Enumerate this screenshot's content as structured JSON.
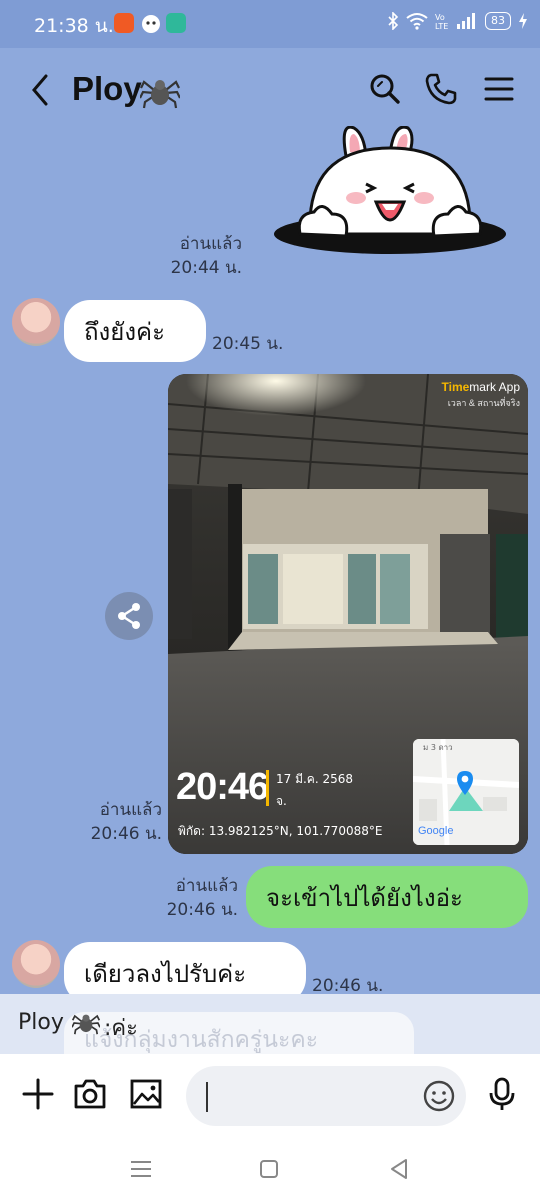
{
  "status_bar": {
    "time": "21:38 น.",
    "battery": "83",
    "colors": {
      "app1": "#f05a24",
      "app3": "#2fb89a"
    },
    "icons": [
      "bluetooth-icon",
      "wifi-icon",
      "volte-icon",
      "signal-icon",
      "battery-icon",
      "charging-icon"
    ]
  },
  "header": {
    "title": "Ploy",
    "icons": [
      "back-icon",
      "spider-emoji",
      "search-icon",
      "call-icon",
      "menu-icon"
    ]
  },
  "messages": [
    {
      "type": "sticker",
      "side": "right",
      "name": "cony-bunny-sticker",
      "read": "อ่านแล้ว",
      "time": "20:44 น."
    },
    {
      "type": "text",
      "side": "left",
      "text": "ถึงยังค่ะ",
      "time": "20:45 น."
    },
    {
      "type": "image",
      "side": "right",
      "read": "อ่านแล้ว",
      "time": "20:46 น.",
      "stamp": {
        "brand_accent": "Time",
        "brand_rest": "mark App",
        "brand_sub": "เวลา & สถานที่จริง",
        "time": "20:46",
        "date": "17 มี.ค. 2568",
        "weekday": "จ.",
        "coords": "พิกัด: 13.982125°N, 101.770088°E",
        "map_label": "ม 3 ดาว",
        "map_brand": "Google"
      }
    },
    {
      "type": "text",
      "side": "right",
      "text": "จะเข้าไปได้ยังไงอ่ะ",
      "read": "อ่านแล้ว",
      "time": "20:46 น."
    },
    {
      "type": "text",
      "side": "left",
      "text": "เดียวลงไปรับค่ะ",
      "time": "20:46 น."
    }
  ],
  "preview": {
    "sender": "Ploy",
    "tail": ":ค่ะ",
    "ghost_text": "แจ้งกลุ่มงานสักครู่นะคะ"
  },
  "composer": {
    "placeholder": "",
    "icons": [
      "plus-icon",
      "camera-icon",
      "image-icon",
      "emoji-icon",
      "microphone-icon"
    ]
  },
  "nav_bar": {
    "icons": [
      "recent-apps-icon",
      "home-icon",
      "back-nav-icon"
    ]
  },
  "colors": {
    "background": "#8ea9dc",
    "bubble_sent": "#86de7b",
    "bubble_received": "#ffffff",
    "timemark_accent": "#f5b700"
  }
}
